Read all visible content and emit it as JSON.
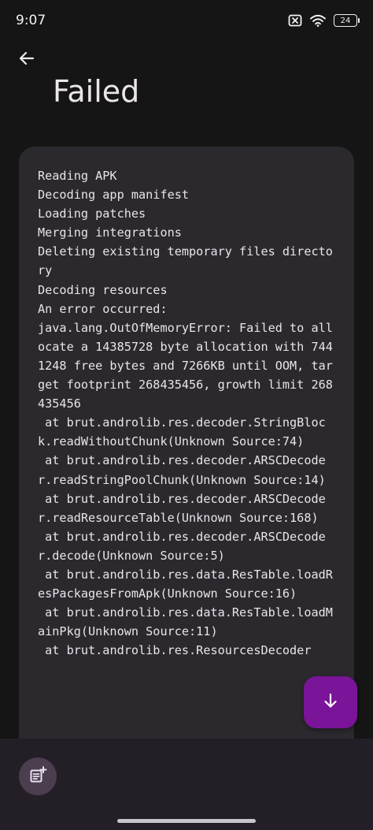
{
  "status_bar": {
    "time": "9:07",
    "battery_level": "24",
    "icons": [
      "sim-off-icon",
      "wifi-icon",
      "battery-icon"
    ]
  },
  "header": {
    "back_icon": "arrow-back-icon",
    "title": "Failed"
  },
  "log": {
    "lines": [
      "Reading APK",
      "Decoding app manifest",
      "Loading patches",
      "Merging integrations",
      "Deleting existing temporary files directory",
      "Decoding resources",
      "An error occurred:",
      "java.lang.OutOfMemoryError: Failed to allocate a 14385728 byte allocation with 7441248 free bytes and 7266KB until OOM, target footprint 268435456, growth limit 268435456",
      " at brut.androlib.res.decoder.StringBlock.readWithoutChunk(Unknown Source:74)",
      " at brut.androlib.res.decoder.ARSCDecoder.readStringPoolChunk(Unknown Source:14)",
      " at brut.androlib.res.decoder.ARSCDecoder.readResourceTable(Unknown Source:168)",
      " at brut.androlib.res.decoder.ARSCDecoder.decode(Unknown Source:5)",
      " at brut.androlib.res.data.ResTable.loadResPackagesFromApk(Unknown Source:16)",
      " at brut.androlib.res.data.ResTable.loadMainPkg(Unknown Source:11)",
      " at brut.androlib.res.ResourcesDecoder"
    ]
  },
  "actions": {
    "export_icon": "note-add-icon",
    "scroll_down_icon": "arrow-downward-icon"
  },
  "colors": {
    "background": "#151515",
    "card": "#2b292e",
    "accent_fab": "#7a1499",
    "bottom_bar": "#241f26"
  }
}
